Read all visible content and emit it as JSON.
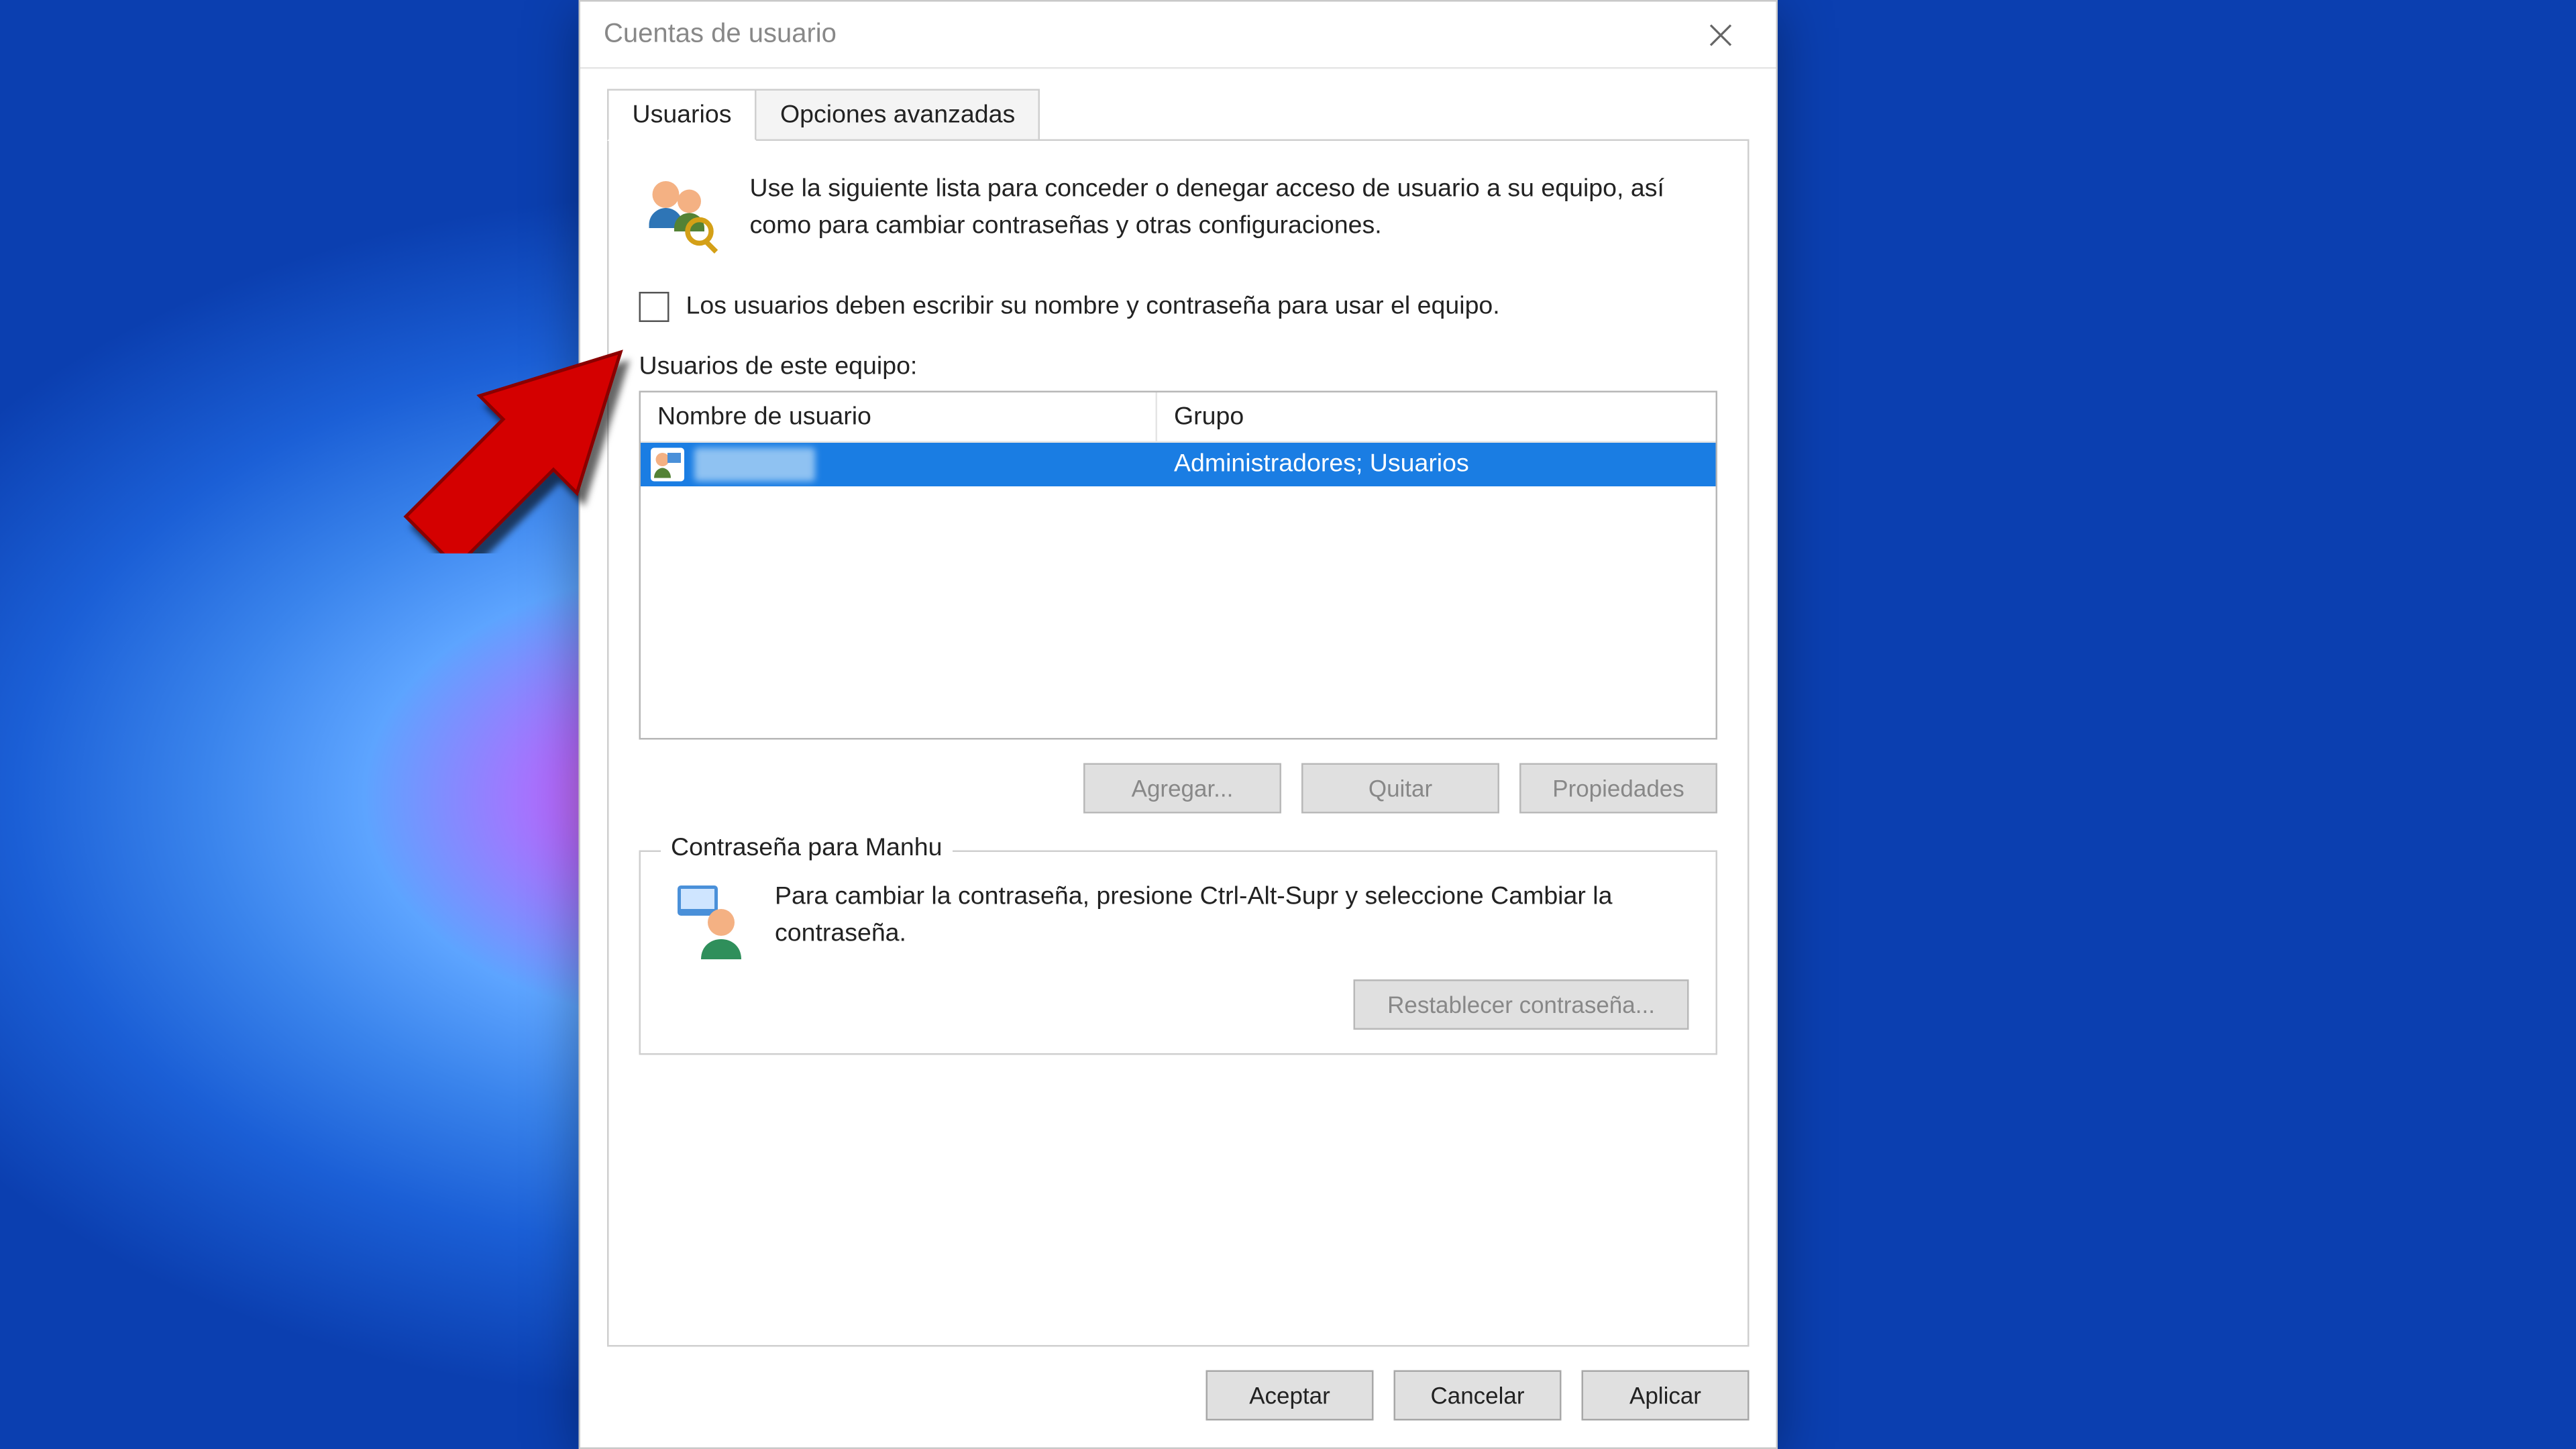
{
  "window": {
    "title": "Cuentas de usuario"
  },
  "tabs": {
    "users": "Usuarios",
    "advanced": "Opciones avanzadas"
  },
  "intro_text": "Use la siguiente lista para conceder o denegar acceso de usuario a su equipo, así como para cambiar contraseñas y otras configuraciones.",
  "checkbox_label": "Los usuarios deben escribir su nombre y contraseña para usar el equipo.",
  "list_label": "Usuarios de este equipo:",
  "columns": {
    "username": "Nombre de usuario",
    "group": "Grupo"
  },
  "rows": [
    {
      "group": "Administradores; Usuarios"
    }
  ],
  "buttons": {
    "add": "Agregar...",
    "remove": "Quitar",
    "properties": "Propiedades",
    "reset_pw": "Restablecer contraseña...",
    "ok": "Aceptar",
    "cancel": "Cancelar",
    "apply": "Aplicar"
  },
  "password_group": {
    "title": "Contraseña para Manhu",
    "text": "Para cambiar la contraseña, presione Ctrl-Alt-Supr y seleccione Cambiar la contraseña."
  }
}
